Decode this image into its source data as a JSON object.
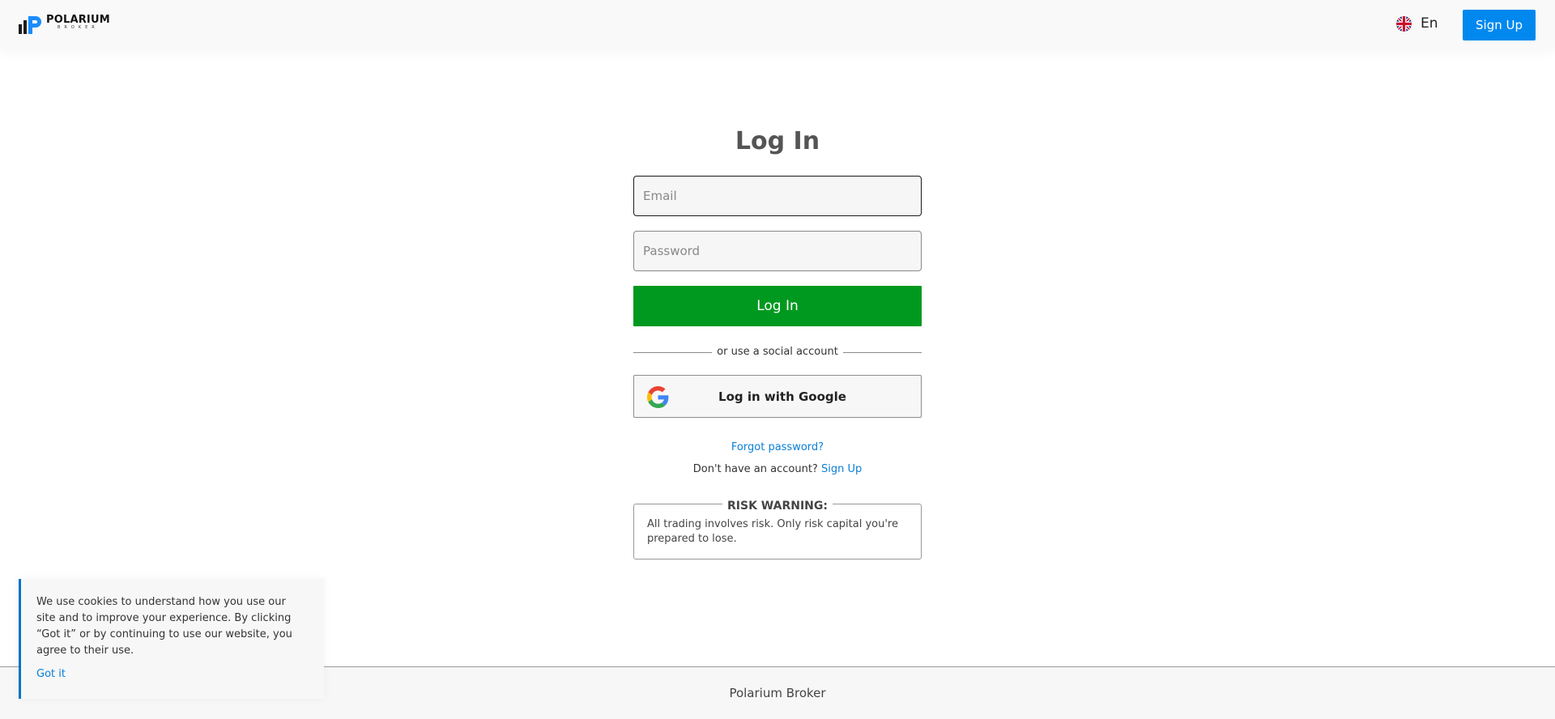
{
  "header": {
    "brand_name": "POLARIUM",
    "brand_sub": "BROKER",
    "language": "En",
    "signup_label": "Sign Up"
  },
  "login": {
    "title": "Log In",
    "email_placeholder": "Email",
    "password_placeholder": "Password",
    "submit_label": "Log In",
    "divider_text": "or use a social account",
    "google_label": "Log in with Google",
    "forgot_label": "Forgot password?",
    "no_account_text": "Don't have an account?",
    "signup_link": "Sign Up"
  },
  "risk": {
    "title": "RISK WARNING:",
    "text": "All trading involves risk. Only risk capital you're prepared to lose."
  },
  "cookie": {
    "text": "We use cookies to understand how you use our site and to improve your experience. By clicking “Got it” or by continuing to use our website, you agree to their use.",
    "button": "Got it"
  },
  "footer": {
    "text": "Polarium Broker"
  },
  "colors": {
    "primary_blue": "#0088ee",
    "login_green": "#00991f",
    "link_blue": "#0a7fd6"
  },
  "icons": {
    "logo": "polarium-logo-icon",
    "flag": "uk-flag-icon",
    "google": "google-icon"
  }
}
